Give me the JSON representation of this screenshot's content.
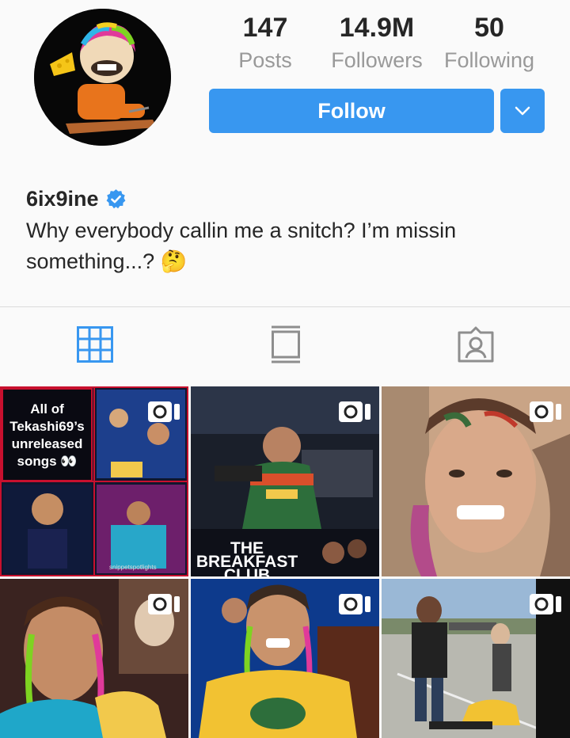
{
  "profile": {
    "username": "6ix9ine",
    "bio": "Why everybody callin me a snitch? I’m missin something...? 🤔",
    "avatar_icon": "profile-avatar-cartoon"
  },
  "stats": {
    "posts": {
      "value": "147",
      "label": "Posts"
    },
    "followers": {
      "value": "14.9M",
      "label": "Followers"
    },
    "following": {
      "value": "50",
      "label": "Following"
    }
  },
  "actions": {
    "follow_label": "Follow",
    "dropdown_icon": "chevron-down-icon",
    "accent_color": "#3897f0"
  },
  "tabs": [
    {
      "name": "grid-view",
      "icon": "grid-icon",
      "active": true
    },
    {
      "name": "feed-view",
      "icon": "feed-icon",
      "active": false
    },
    {
      "name": "tagged",
      "icon": "tagged-user-icon",
      "active": false
    }
  ],
  "posts": [
    {
      "type": "video",
      "overlay_text": "All of Tekashi69’s unreleased songs 👀",
      "credit": "snippetspotlights"
    },
    {
      "type": "video",
      "caption_line1": "THE BREAKFAST",
      "caption_line2": "CLUB"
    },
    {
      "type": "video"
    },
    {
      "type": "video"
    },
    {
      "type": "video"
    },
    {
      "type": "video"
    }
  ]
}
